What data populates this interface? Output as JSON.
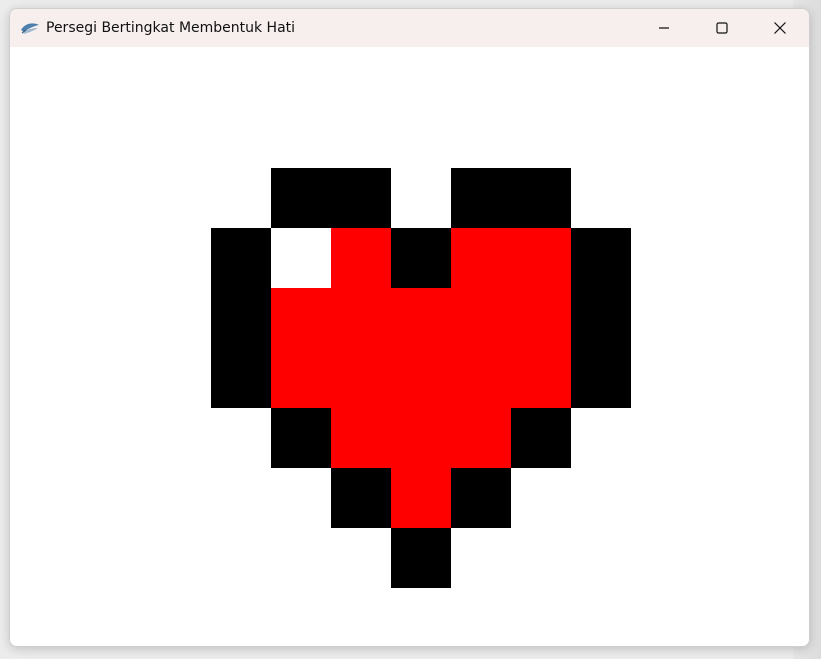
{
  "window": {
    "title": "Persegi Bertingkat Membentuk Hati",
    "icon": "python-feather-icon",
    "controls": [
      "minimize",
      "maximize",
      "close"
    ]
  },
  "colors": {
    "outline": "#000000",
    "fill": "#ff0000",
    "highlight": "#ffffff",
    "titlebar": "#f7efee"
  },
  "heart": {
    "grid_cols": 7,
    "grid_rows": 7,
    "rows": [
      "_BB_BB_",
      "BWRBRRB",
      "BRRRRRB",
      "BRRRRRB",
      "_BRRRB_",
      "__BRB__",
      "___B___"
    ],
    "legend": {
      "B": "outline",
      "R": "fill",
      "W": "highlight",
      "_": "empty"
    }
  }
}
